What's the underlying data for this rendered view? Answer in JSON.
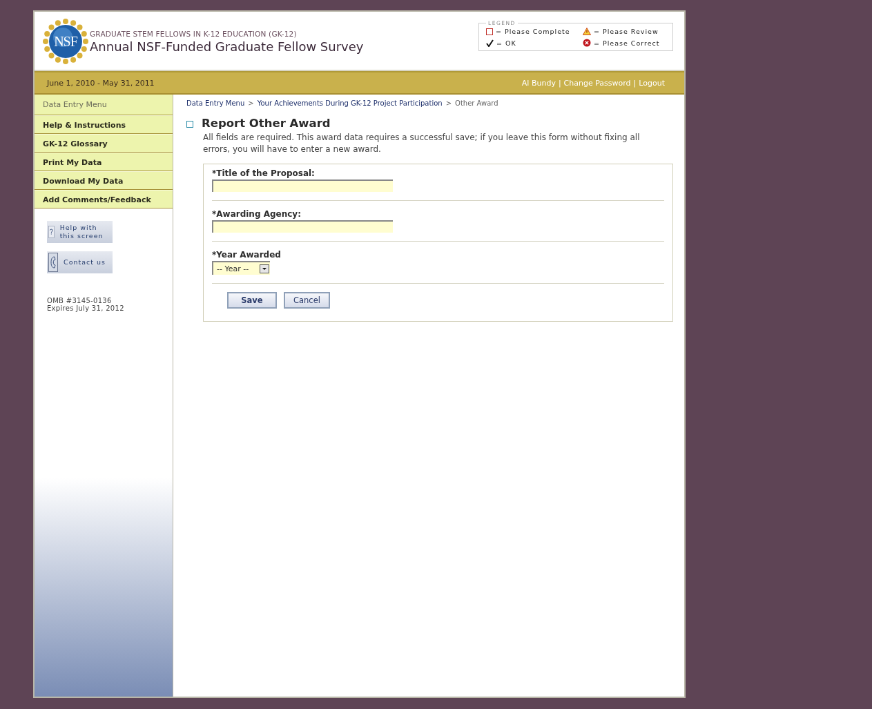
{
  "header": {
    "program": "GRADUATE STEM FELLOWS IN K-12 EDUCATION (GK-12)",
    "title": "Annual NSF-Funded Graduate Fellow Survey",
    "logo_text": "NSF"
  },
  "legend": {
    "title": "LEGEND",
    "items": [
      {
        "kind": "complete",
        "label": "= Please Complete"
      },
      {
        "kind": "review",
        "label": "= Please Review"
      },
      {
        "kind": "ok",
        "label": "= OK"
      },
      {
        "kind": "correct",
        "label": "= Please Correct"
      }
    ]
  },
  "top_bar": {
    "period": "June 1, 2010 - May 31, 2011",
    "separator": "|",
    "links": [
      "Al Bundy",
      "Change Password",
      "Logout"
    ]
  },
  "sidebar": {
    "items": [
      {
        "kind": "header",
        "label": "Data Entry Menu"
      },
      {
        "kind": "link",
        "label": "Help & Instructions"
      },
      {
        "kind": "link",
        "label": "GK-12 Glossary"
      },
      {
        "kind": "link",
        "label": "Print My Data"
      },
      {
        "kind": "link",
        "label": "Download My Data"
      },
      {
        "kind": "link",
        "label": "Add Comments/Feedback"
      }
    ],
    "buttons": [
      {
        "kind": "help",
        "label": "Help with this screen"
      },
      {
        "kind": "contact",
        "label": "Contact us"
      }
    ],
    "omb": [
      "OMB #3145-0136",
      "Expires July 31, 2012"
    ]
  },
  "breadcrumb": {
    "separator": ">",
    "items": [
      {
        "label": "Data Entry Menu",
        "link": true
      },
      {
        "label": "Your Achievements During GK-12 Project Participation",
        "link": true
      },
      {
        "label": "Other Award",
        "link": false
      }
    ]
  },
  "page": {
    "title": "Report Other Award",
    "description": "All fields are required. This award data requires a successful save; if you leave this form without fixing all errors, you will have to enter a new award."
  },
  "form": {
    "fields": [
      {
        "kind": "text",
        "label": "*Title of the Proposal:"
      },
      {
        "kind": "text",
        "label": "*Awarding Agency:"
      },
      {
        "kind": "select",
        "label": "*Year Awarded",
        "value": "-- Year --"
      }
    ],
    "buttons": [
      {
        "kind": "primary",
        "label": "Save"
      },
      {
        "kind": "secondary",
        "label": "Cancel"
      }
    ]
  }
}
